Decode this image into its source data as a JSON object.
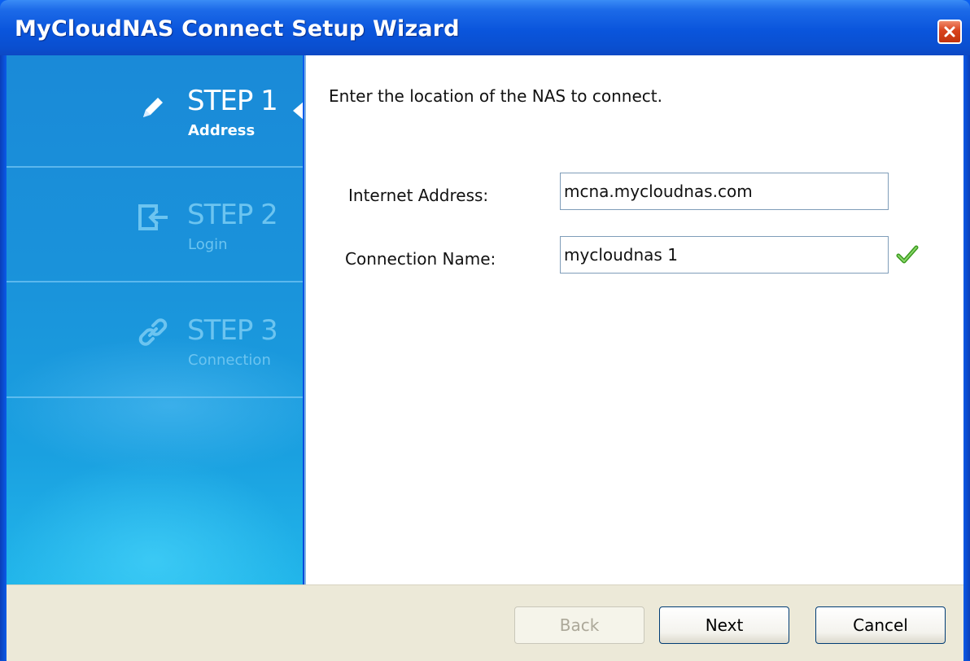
{
  "window": {
    "title": "MyCloudNAS Connect Setup Wizard",
    "close_icon": "close-icon"
  },
  "sidebar": {
    "steps": [
      {
        "title": "STEP 1",
        "subtitle": "Address",
        "icon": "pencil-icon",
        "state": "active"
      },
      {
        "title": "STEP 2",
        "subtitle": "Login",
        "icon": "login-icon",
        "state": "inactive"
      },
      {
        "title": "STEP 3",
        "subtitle": "Connection",
        "icon": "link-icon",
        "state": "inactive"
      }
    ]
  },
  "main": {
    "instruction": "Enter the location of the NAS to connect.",
    "internet_address": {
      "label": "Internet Address:",
      "value": "mcna.mycloudnas.com"
    },
    "connection_name": {
      "label": "Connection Name:",
      "value": "mycloudnas 1",
      "status_icon": "checkmark-icon"
    }
  },
  "footer": {
    "back_label": "Back",
    "next_label": "Next",
    "cancel_label": "Cancel"
  },
  "colors": {
    "title_bar": "#0a55dc",
    "sidebar": "#1a92da",
    "active_step_text": "#ffffff",
    "inactive_step_text": "#6cc4f0",
    "footer_bg": "#ece9d8",
    "check_green": "#3a9a1e"
  }
}
